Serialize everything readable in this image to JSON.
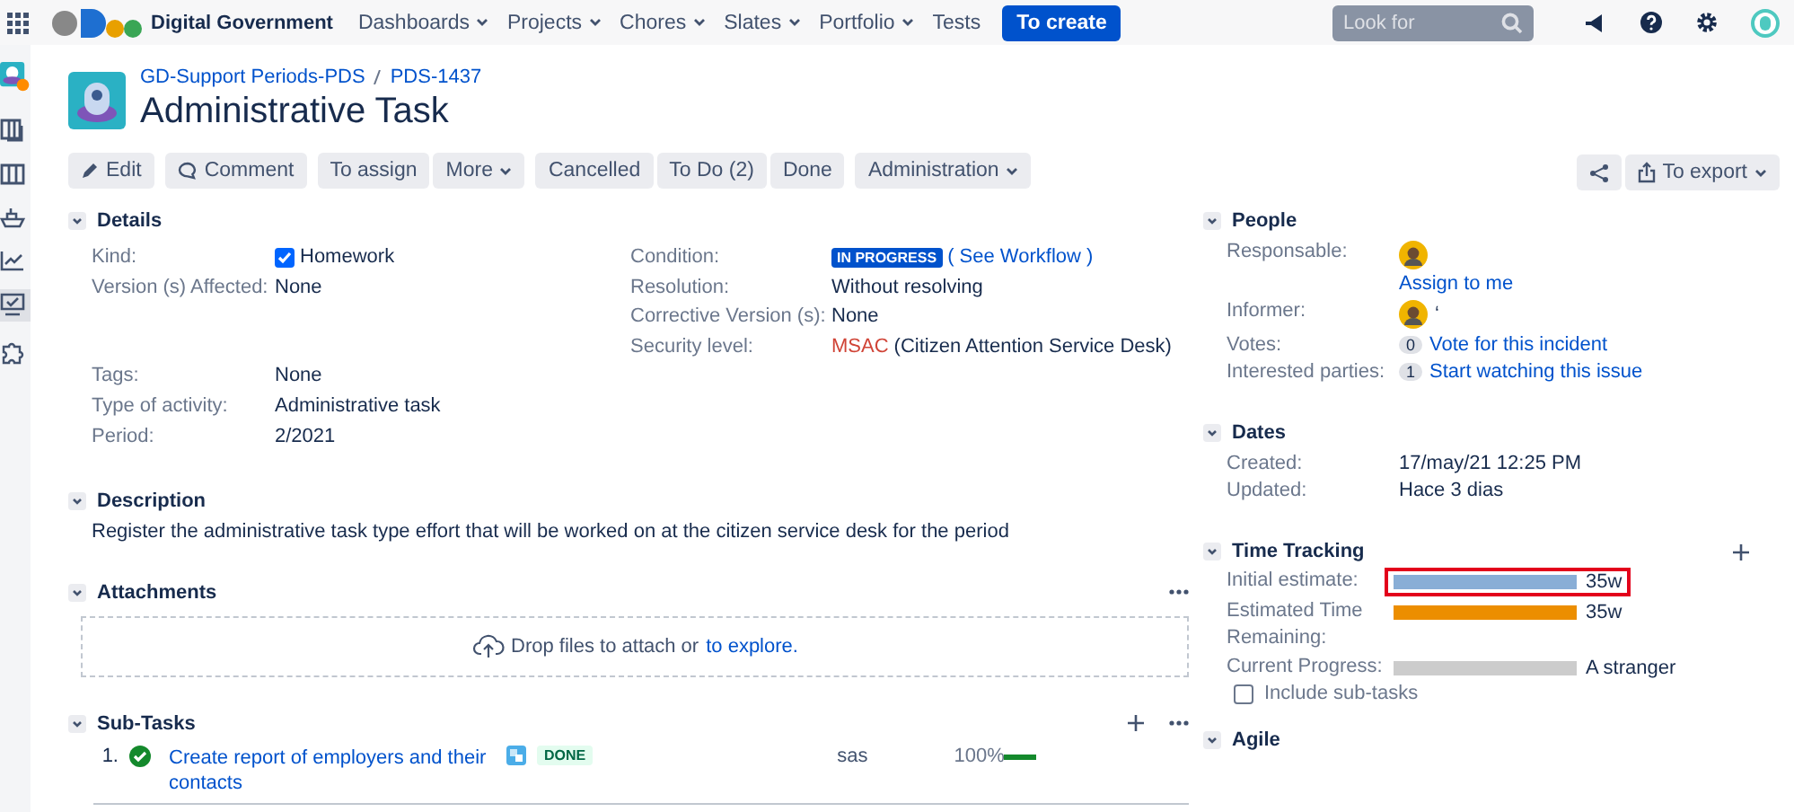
{
  "topbar": {
    "brand": "Digital Government",
    "menu": [
      {
        "label": "Dashboards",
        "dropdown": true
      },
      {
        "label": "Projects",
        "dropdown": true
      },
      {
        "label": "Chores",
        "dropdown": true
      },
      {
        "label": "Slates",
        "dropdown": true
      },
      {
        "label": "Portfolio",
        "dropdown": true
      },
      {
        "label": "Tests",
        "dropdown": false
      }
    ],
    "create": "To create",
    "search": {
      "placeholder": "Look for"
    }
  },
  "sidebar": {
    "items": [
      {
        "kind": "avatar",
        "selected": false
      },
      {
        "kind": "board",
        "selected": false
      },
      {
        "kind": "columns",
        "selected": false
      },
      {
        "kind": "ship",
        "selected": false
      },
      {
        "kind": "chart",
        "selected": false
      },
      {
        "kind": "monitor",
        "selected": true
      },
      {
        "kind": "puzzle",
        "selected": false
      }
    ]
  },
  "issue": {
    "breadcrumb": [
      "GD-Support Periods-PDS",
      "PDS-1437"
    ],
    "title": "Administrative Task"
  },
  "toolbar": {
    "groups": [
      [
        {
          "label": "Edit",
          "kind": "edit",
          "dropdown": false
        }
      ],
      [
        {
          "label": "Comment",
          "kind": "comment",
          "dropdown": false
        }
      ],
      [
        {
          "label": "To assign",
          "kind": "plain",
          "dropdown": false
        },
        {
          "label": "More",
          "kind": "plain",
          "dropdown": true
        }
      ],
      [
        {
          "label": "Cancelled",
          "kind": "plain",
          "dropdown": false
        },
        {
          "label": "To Do (2)",
          "kind": "plain",
          "dropdown": false
        },
        {
          "label": "Done",
          "kind": "plain",
          "dropdown": false
        }
      ],
      [
        {
          "label": "Administration",
          "kind": "plain",
          "dropdown": true
        }
      ]
    ],
    "export": "To export"
  },
  "details": {
    "title": "Details",
    "left": [
      {
        "label": "Kind:",
        "kind": "checkbox",
        "value": "Homework",
        "checked": true
      },
      {
        "label": "Version (s) Affected:",
        "kind": "text",
        "value": "None"
      },
      {
        "label": "Tags:",
        "kind": "text",
        "value": "None"
      },
      {
        "label": "Type of activity:",
        "kind": "text",
        "value": "Administrative task"
      },
      {
        "label": "Period:",
        "kind": "text",
        "value": "2/2021"
      }
    ],
    "right": [
      {
        "label": "Condition:",
        "kind": "status",
        "value": "IN PROGRESS",
        "link": "( See Workflow )"
      },
      {
        "label": "Resolution:",
        "kind": "text",
        "value": "Without resolving"
      },
      {
        "label": "Corrective Version (s):",
        "kind": "text",
        "value": "None"
      },
      {
        "label": "Security level:",
        "kind": "security",
        "value": "MSAC",
        "extra": "(Citizen Attention Service Desk)"
      }
    ]
  },
  "description": {
    "title": "Description",
    "text": "Register the administrative task type effort that will be worked on at the citizen service desk for the period"
  },
  "attachments": {
    "title": "Attachments",
    "drop": "Drop files to attach or",
    "link": "to explore."
  },
  "subtasks": {
    "title": "Sub-Tasks",
    "rows": [
      {
        "number": "1.",
        "summary": "Create report of employers and their contacts",
        "status": "DONE",
        "assignee": "sas",
        "percent": "100%",
        "level": 1
      }
    ]
  },
  "people": {
    "title": "People",
    "responsable_label": "Responsable:",
    "assign_link": "Assign to me",
    "informer_label": "Informer:",
    "informer_name": "‘",
    "votes_label": "Votes:",
    "votes_count": "0",
    "votes_link": "Vote for this incident",
    "watchers_label": "Interested parties:",
    "watchers_count": "1",
    "watchers_link": "Start watching this issue"
  },
  "dates": {
    "title": "Dates",
    "rows": [
      {
        "label": "Created:",
        "value": "17/may/21 12:25 PM"
      },
      {
        "label": "Updated:",
        "value": "Hace 3 dias"
      }
    ]
  },
  "time_tracking": {
    "title": "Time Tracking",
    "rows": [
      {
        "label": "Initial estimate:",
        "kind": "estimate",
        "level": 1,
        "value": "35w",
        "highlighted": true
      },
      {
        "label": "Estimated Time Remaining:",
        "kind": "remaining",
        "level": 1,
        "value": "35w",
        "highlighted": false
      },
      {
        "label": "Current Progress:",
        "kind": "progress",
        "level": 0,
        "value": "A stranger",
        "highlighted": false
      }
    ],
    "include_subtasks": {
      "label": "Include sub-tasks",
      "checked": false
    }
  },
  "agile": {
    "title": "Agile"
  }
}
